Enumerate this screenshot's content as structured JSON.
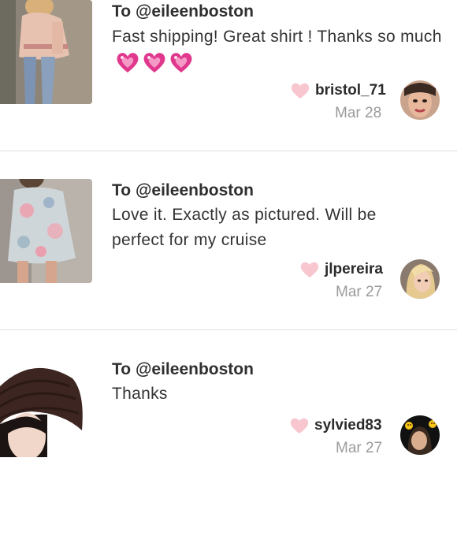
{
  "reviews": [
    {
      "to_prefix": "To ",
      "handle": "@eileenboston",
      "comment": "Fast shipping! Great shirt ! Thanks so much",
      "emoji_hearts": 3,
      "username": "bristol_71",
      "date": "Mar 28",
      "thumb_icon": "pink-tunic-outfit-photo",
      "avatar_icon": "user-avatar-glam"
    },
    {
      "to_prefix": "To ",
      "handle": "@eileenboston",
      "comment": "Love it. Exactly as pictured. Will be perfect for my cruise",
      "emoji_hearts": 0,
      "username": "jlpereira",
      "date": "Mar 27",
      "thumb_icon": "floral-romper-photo",
      "avatar_icon": "user-avatar-blonde"
    },
    {
      "to_prefix": "To ",
      "handle": "@eileenboston",
      "comment": "Thanks",
      "emoji_hearts": 0,
      "username": "sylvied83",
      "date": "Mar 27",
      "thumb_icon": "brown-beanie-photo",
      "avatar_icon": "user-avatar-emoji"
    }
  ],
  "colors": {
    "like_heart": "#f7c6cf",
    "emoji_heart": "#e0388c",
    "divider": "#dcdcdc",
    "date_text": "#9a9a9a"
  }
}
